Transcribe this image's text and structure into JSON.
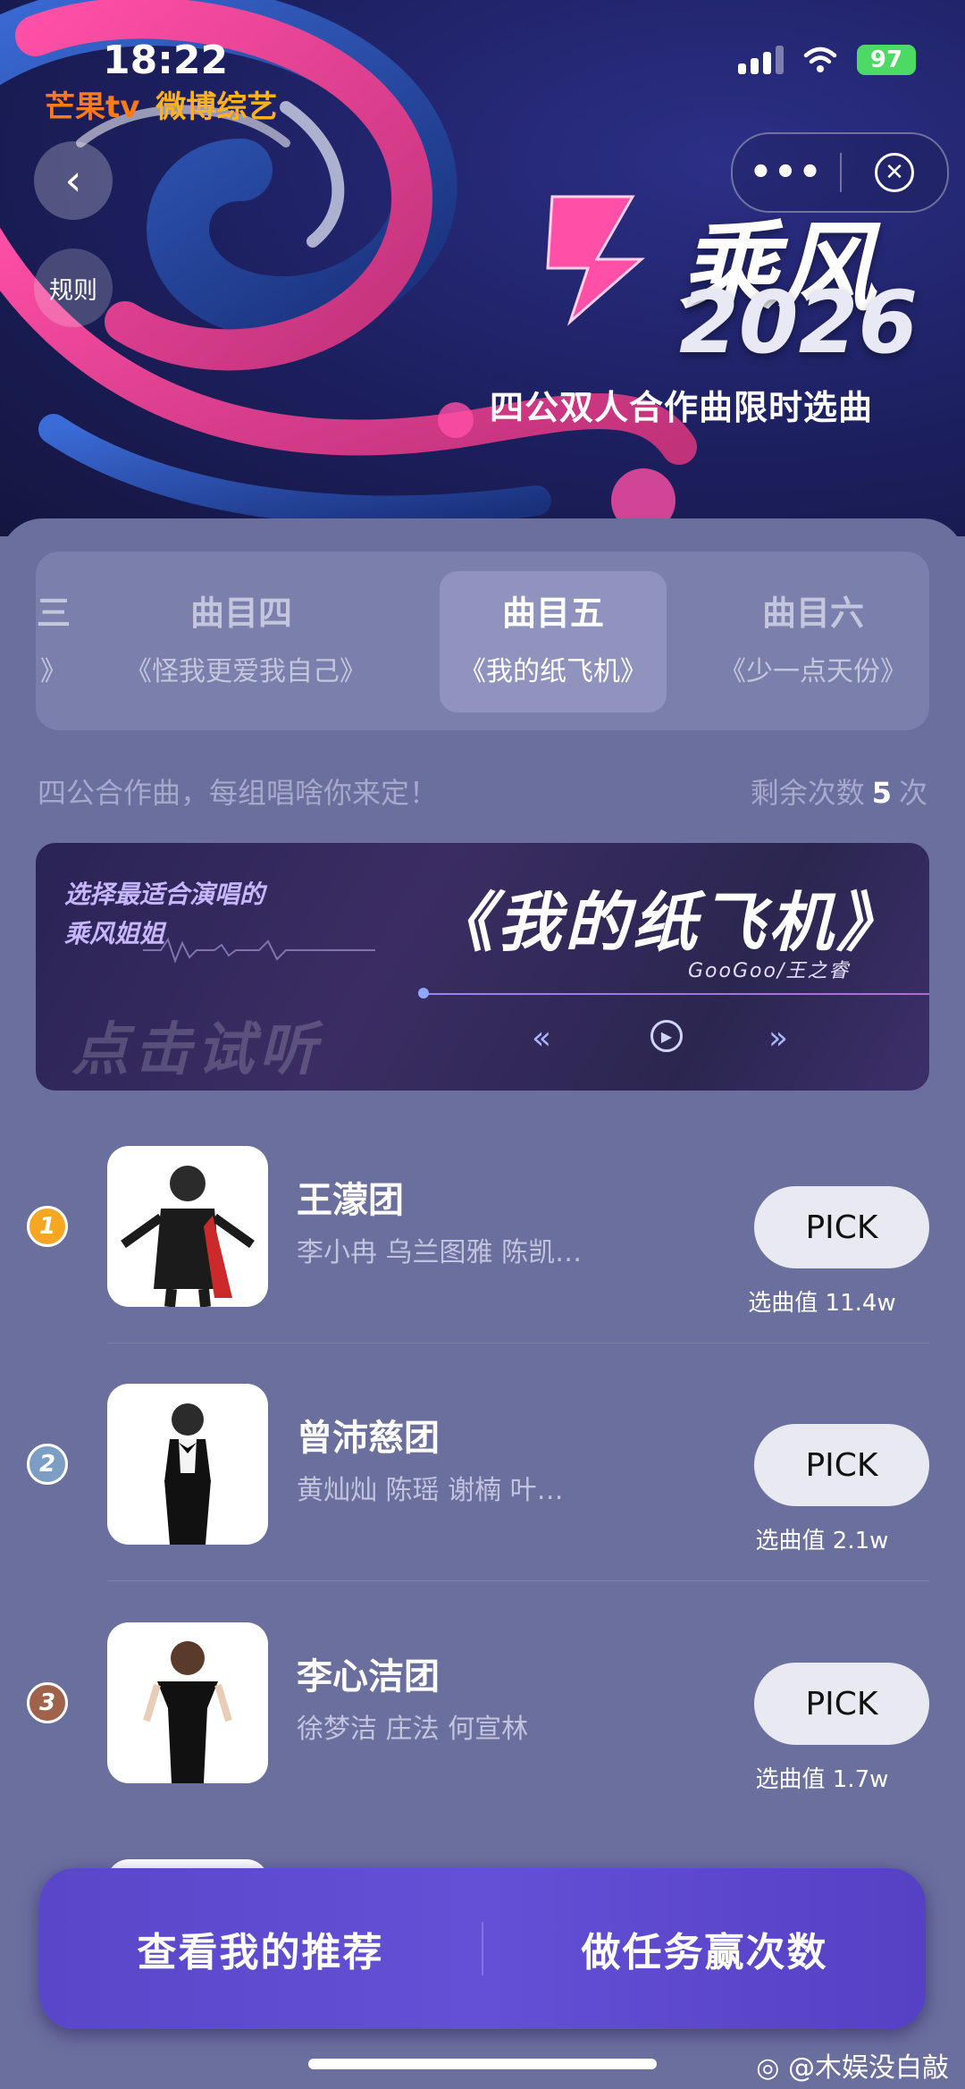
{
  "status": {
    "time": "18:22",
    "battery": "97"
  },
  "header": {
    "logo_mango": "芒果tv",
    "logo_weibo": "微博综艺",
    "back_icon": "chevron-left-icon",
    "rules_label": "规则",
    "more_icon": "more-dots-icon",
    "close_icon": "close-circle-icon",
    "brand_title": "乘风",
    "brand_year": "2026",
    "subtitle": "四公双人合作曲限时选曲"
  },
  "tabs": [
    {
      "title": "三",
      "song": "》",
      "active": false
    },
    {
      "title": "曲目四",
      "song": "《怪我更爱我自己》",
      "active": false
    },
    {
      "title": "曲目五",
      "song": "《我的纸飞机》",
      "active": true
    },
    {
      "title": "曲目六",
      "song": "《少一点天份》",
      "active": false
    }
  ],
  "intro": "四公合作曲，每组唱啥你来定！",
  "remaining": {
    "label": "剩余次数",
    "count": "5",
    "unit": "次"
  },
  "banner": {
    "line1": "选择最适合演唱的",
    "line2": "乘风姐姐",
    "song": "《我的纸飞机》",
    "artist": "GooGoo/王之睿",
    "listen": "点击试听"
  },
  "teams": [
    {
      "rank": "1",
      "name": "王濛团",
      "members": "李小冉 乌兰图雅 陈凯…",
      "pick": "PICK",
      "score": "选曲值 11.4w",
      "rank_color": "#f5a623"
    },
    {
      "rank": "2",
      "name": "曾沛慈团",
      "members": "黄灿灿 陈瑶 谢楠 叶…",
      "pick": "PICK",
      "score": "选曲值 2.1w",
      "rank_color": "#7d9ec4"
    },
    {
      "rank": "3",
      "name": "李心洁团",
      "members": "徐梦洁 庄法 何宣林",
      "pick": "PICK",
      "score": "选曲值 1.7w",
      "rank_color": "#a0624a"
    }
  ],
  "bottom": {
    "recommend": "查看我的推荐",
    "tasks": "做任务赢次数"
  },
  "watermark": "@木娱没白敲"
}
